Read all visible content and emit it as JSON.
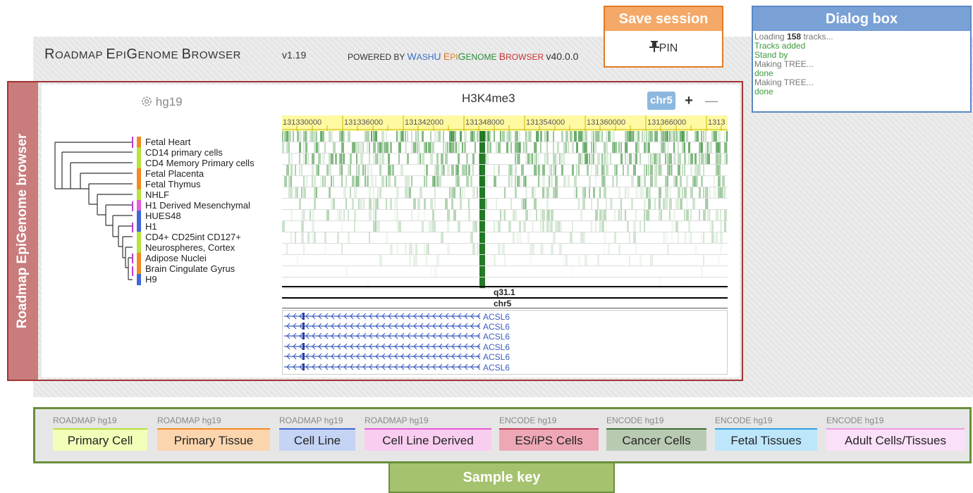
{
  "header": {
    "title_caps": [
      "R",
      "OADMAP ",
      "E",
      "PI",
      "G",
      "ENOME ",
      "B",
      "ROWSER"
    ],
    "version": "v1.19",
    "powered_by": "POWERED BY",
    "washu_w": "W",
    "washu_rest": "ASH",
    "washu_u": "U",
    "epi_e": "E",
    "epi_rest": "PI",
    "genome_g": "G",
    "genome_rest": "ENOME",
    "browser_b": "B",
    "browser_rest": "ROWSER",
    "browser_version": "v40.0.0"
  },
  "save_session": {
    "title": "Save session",
    "pin_label": "PIN",
    "pin_icon": "pin-icon"
  },
  "dialog": {
    "title": "Dialog box",
    "log_loading_pre": "Loading",
    "log_loading_count": "158",
    "log_loading_post": "tracks...",
    "log": [
      "Tracks added",
      "Stand by",
      "Making TREE...",
      "done",
      "Making TREE...",
      "done"
    ]
  },
  "browser": {
    "side_label": "Roadmap EpiGenome browser",
    "genome": "hg19",
    "genome_icon": "gear-icon",
    "track_title": "H3K4me3",
    "chrom_button": "chr5",
    "zoom_in": "+",
    "zoom_out": "—",
    "ruler_ticks": [
      "131330000",
      "131336000",
      "131342000",
      "131348000",
      "131354000",
      "131360000",
      "131366000",
      "1313"
    ],
    "cytoband": "q31.1",
    "chrom_label": "chr5",
    "gene_name": "ACSL6",
    "samples": [
      {
        "name": "Fetal Heart",
        "color": "#f28a1e"
      },
      {
        "name": "CD14 primary cells",
        "color": "#b7e23a"
      },
      {
        "name": "CD4 Memory Primary cells",
        "color": "#b7e23a"
      },
      {
        "name": "Fetal Placenta",
        "color": "#f28a1e"
      },
      {
        "name": "Fetal Thymus",
        "color": "#f28a1e"
      },
      {
        "name": "NHLF",
        "color": "#b7e23a"
      },
      {
        "name": "H1 Derived Mesenchymal",
        "color": "#e85ad6"
      },
      {
        "name": "HUES48",
        "color": "#3f67d8"
      },
      {
        "name": "H1",
        "color": "#3f67d8"
      },
      {
        "name": "CD4+ CD25int CD127+",
        "color": "#b7e23a"
      },
      {
        "name": "Neurospheres, Cortex",
        "color": "#b7e23a"
      },
      {
        "name": "Adipose Nuclei",
        "color": "#f28a1e"
      },
      {
        "name": "Brain Cingulate Gyrus",
        "color": "#f28a1e"
      },
      {
        "name": "H9",
        "color": "#3f67d8"
      }
    ]
  },
  "sample_key": {
    "title": "Sample key",
    "items": [
      {
        "source": "ROADMAP hg19",
        "label": "Primary Cell",
        "bg": "#f2ffb8",
        "border": "#b6e03c"
      },
      {
        "source": "ROADMAP hg19",
        "label": "Primary Tissue",
        "bg": "#fbd5ae",
        "border": "#f28a1e"
      },
      {
        "source": "ROADMAP hg19",
        "label": "Cell Line",
        "bg": "#c5d3f5",
        "border": "#3f67d8"
      },
      {
        "source": "ROADMAP hg19",
        "label": "Cell Line Derived",
        "bg": "#f8cdef",
        "border": "#e85ad6"
      },
      {
        "source": "ENCODE hg19",
        "label": "ES/iPS Cells",
        "bg": "#eea8b5",
        "border": "#c43c56"
      },
      {
        "source": "ENCODE hg19",
        "label": "Cancer Cells",
        "bg": "#b9cab2",
        "border": "#3e6b2e"
      },
      {
        "source": "ENCODE hg19",
        "label": "Fetal Tissues",
        "bg": "#bde6fb",
        "border": "#2f9fe3"
      },
      {
        "source": "ENCODE hg19",
        "label": "Adult Cells/Tissues",
        "bg": "#fbe0fa",
        "border": "#ea9be6"
      }
    ]
  }
}
